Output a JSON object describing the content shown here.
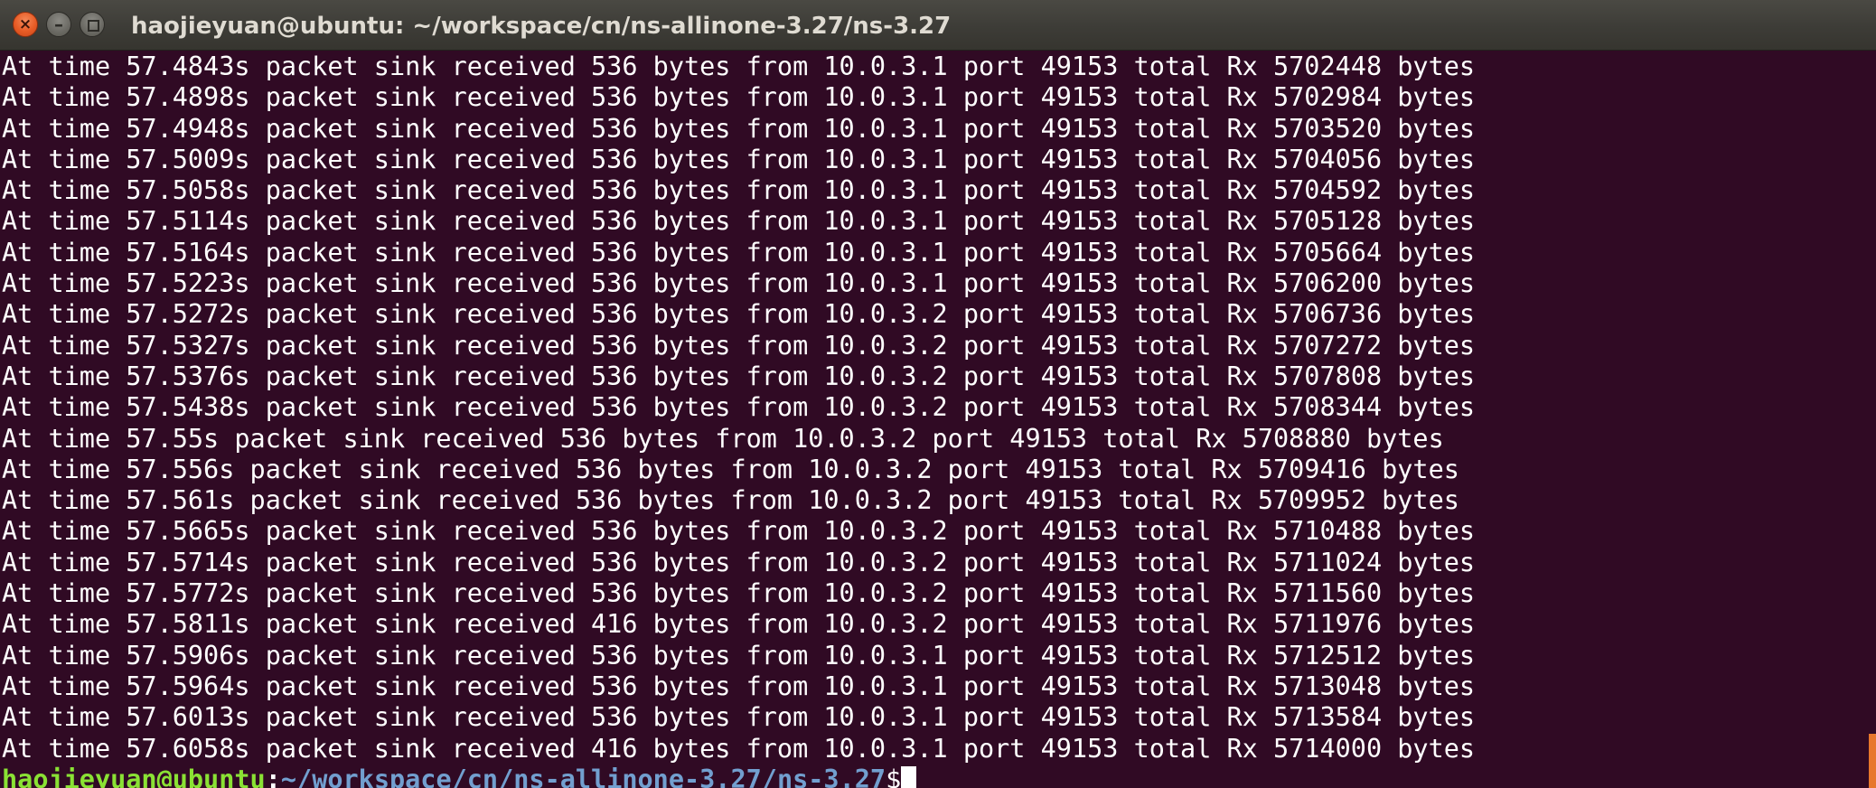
{
  "window": {
    "title": "haojieyuan@ubuntu: ~/workspace/cn/ns-allinone-3.27/ns-3.27",
    "close_glyph": "×",
    "minimize_glyph": "–"
  },
  "terminal": {
    "lines": [
      "At time 57.4843s packet sink received 536 bytes from 10.0.3.1 port 49153 total Rx 5702448 bytes",
      "At time 57.4898s packet sink received 536 bytes from 10.0.3.1 port 49153 total Rx 5702984 bytes",
      "At time 57.4948s packet sink received 536 bytes from 10.0.3.1 port 49153 total Rx 5703520 bytes",
      "At time 57.5009s packet sink received 536 bytes from 10.0.3.1 port 49153 total Rx 5704056 bytes",
      "At time 57.5058s packet sink received 536 bytes from 10.0.3.1 port 49153 total Rx 5704592 bytes",
      "At time 57.5114s packet sink received 536 bytes from 10.0.3.1 port 49153 total Rx 5705128 bytes",
      "At time 57.5164s packet sink received 536 bytes from 10.0.3.1 port 49153 total Rx 5705664 bytes",
      "At time 57.5223s packet sink received 536 bytes from 10.0.3.1 port 49153 total Rx 5706200 bytes",
      "At time 57.5272s packet sink received 536 bytes from 10.0.3.2 port 49153 total Rx 5706736 bytes",
      "At time 57.5327s packet sink received 536 bytes from 10.0.3.2 port 49153 total Rx 5707272 bytes",
      "At time 57.5376s packet sink received 536 bytes from 10.0.3.2 port 49153 total Rx 5707808 bytes",
      "At time 57.5438s packet sink received 536 bytes from 10.0.3.2 port 49153 total Rx 5708344 bytes",
      "At time 57.55s packet sink received 536 bytes from 10.0.3.2 port 49153 total Rx 5708880 bytes",
      "At time 57.556s packet sink received 536 bytes from 10.0.3.2 port 49153 total Rx 5709416 bytes",
      "At time 57.561s packet sink received 536 bytes from 10.0.3.2 port 49153 total Rx 5709952 bytes",
      "At time 57.5665s packet sink received 536 bytes from 10.0.3.2 port 49153 total Rx 5710488 bytes",
      "At time 57.5714s packet sink received 536 bytes from 10.0.3.2 port 49153 total Rx 5711024 bytes",
      "At time 57.5772s packet sink received 536 bytes from 10.0.3.2 port 49153 total Rx 5711560 bytes",
      "At time 57.5811s packet sink received 416 bytes from 10.0.3.2 port 49153 total Rx 5711976 bytes",
      "At time 57.5906s packet sink received 536 bytes from 10.0.3.1 port 49153 total Rx 5712512 bytes",
      "At time 57.5964s packet sink received 536 bytes from 10.0.3.1 port 49153 total Rx 5713048 bytes",
      "At time 57.6013s packet sink received 536 bytes from 10.0.3.1 port 49153 total Rx 5713584 bytes",
      "At time 57.6058s packet sink received 416 bytes from 10.0.3.1 port 49153 total Rx 5714000 bytes"
    ],
    "prompt": {
      "user_host": "haojieyuan@ubuntu",
      "separator": ":",
      "path": "~/workspace/cn/ns-allinone-3.27/ns-3.27",
      "symbol": "$"
    }
  },
  "colors": {
    "background": "#300a24",
    "text": "#ffffff",
    "prompt_user": "#8ae234",
    "prompt_path": "#729fcf",
    "close_button": "#e75b25",
    "scrollbar": "#e7772b"
  },
  "icons": {
    "close": "close-icon",
    "minimize": "minimize-icon",
    "maximize": "maximize-icon"
  }
}
